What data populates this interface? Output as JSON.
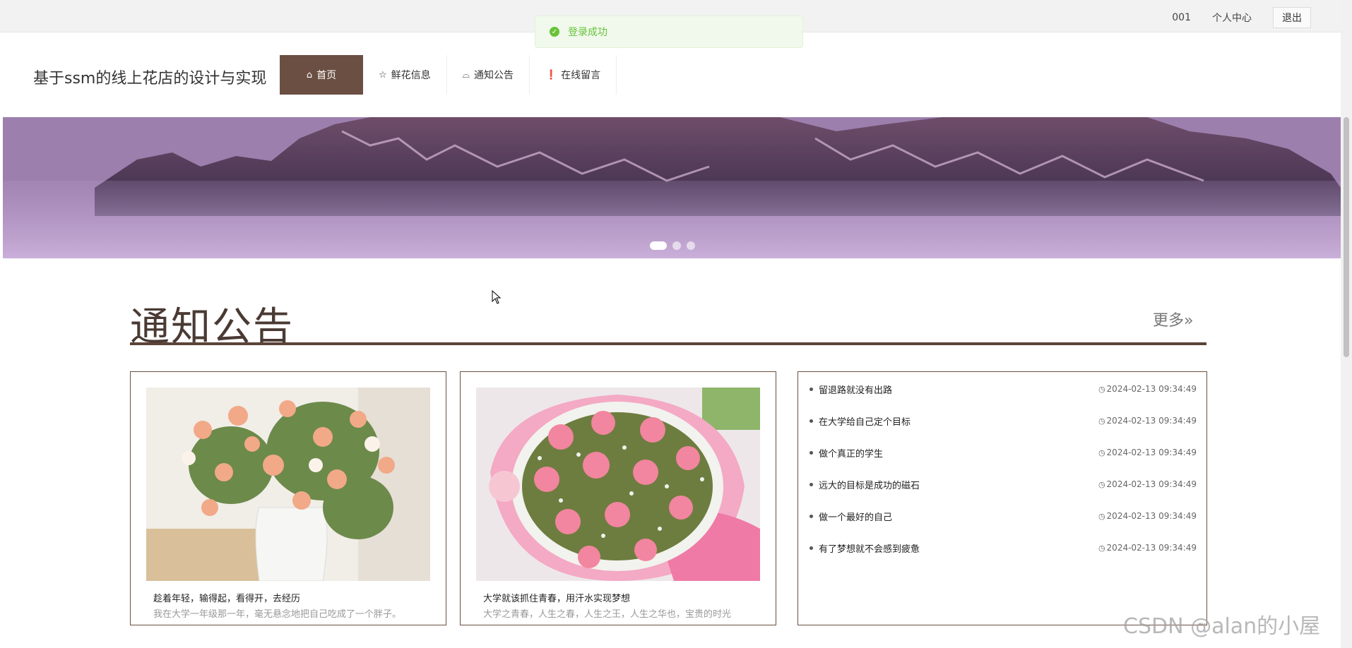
{
  "topbar": {
    "user_id": "001",
    "profile_label": "个人中心",
    "logout_label": "退出"
  },
  "toast": {
    "message": "登录成功",
    "color": "#67c23a"
  },
  "header": {
    "site_title": "基于ssm的线上花店的设计与实现",
    "nav": [
      {
        "label": "首页",
        "icon": "home-icon"
      },
      {
        "label": "鲜花信息",
        "icon": "star-icon"
      },
      {
        "label": "通知公告",
        "icon": "bag-icon"
      },
      {
        "label": "在线留言",
        "icon": "alert-circle-icon"
      }
    ],
    "active_color": "#6b4f42"
  },
  "banner": {
    "slide_count": 3,
    "active_slide": 1
  },
  "section": {
    "title": "通知公告",
    "more_label": "更多»",
    "accent": "#5a4338"
  },
  "cards": [
    {
      "title": "趁着年轻，输得起，看得开，去经历",
      "desc": "我在大学一年级那一年，毫无悬念地把自己吃成了一个胖子。"
    },
    {
      "title": "大学就该抓住青春，用汗水实现梦想",
      "desc": "大学之青春，人生之春，人生之王，人生之华也，宝贵的时光"
    }
  ],
  "news": [
    {
      "title": "留退路就没有出路",
      "time": "2024-02-13 09:34:49"
    },
    {
      "title": "在大学给自己定个目标",
      "time": "2024-02-13 09:34:49"
    },
    {
      "title": "做个真正的学生",
      "time": "2024-02-13 09:34:49"
    },
    {
      "title": "远大的目标是成功的磁石",
      "time": "2024-02-13 09:34:49"
    },
    {
      "title": "做一个最好的自己",
      "time": "2024-02-13 09:34:49"
    },
    {
      "title": "有了梦想就不会感到疲惫",
      "time": "2024-02-13 09:34:49"
    }
  ],
  "watermark": "CSDN @alan的小屋"
}
